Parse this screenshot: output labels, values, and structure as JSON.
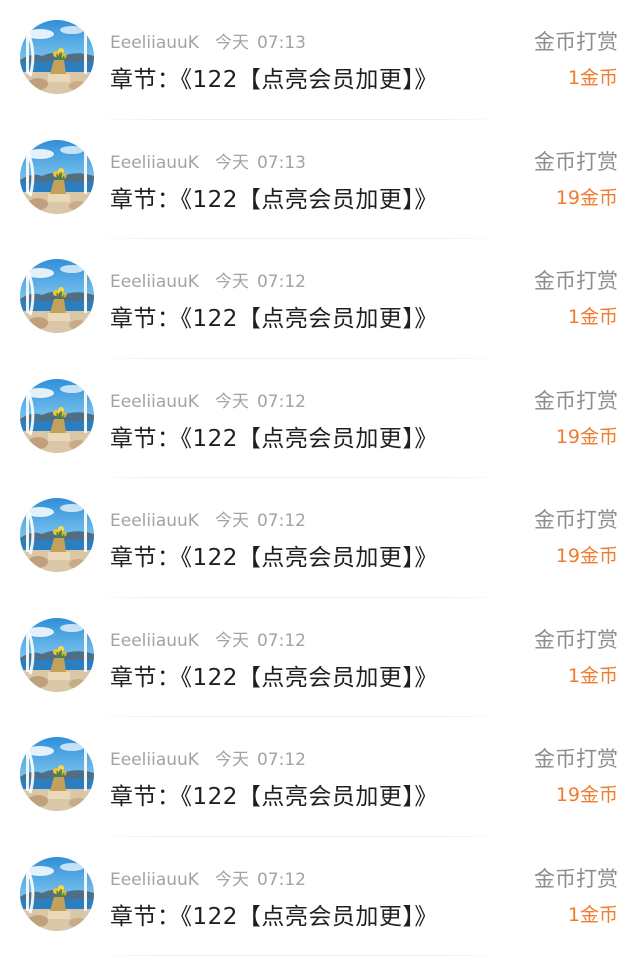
{
  "records": [
    {
      "user": "EeeliiauuK",
      "day": "今天",
      "time": "07:13",
      "chapter": "章节：《122【点亮会员加更】》",
      "reward_type": "金币打赏",
      "amount": "1金币"
    },
    {
      "user": "EeeliiauuK",
      "day": "今天",
      "time": "07:13",
      "chapter": "章节：《122【点亮会员加更】》",
      "reward_type": "金币打赏",
      "amount": "19金币"
    },
    {
      "user": "EeeliiauuK",
      "day": "今天",
      "time": "07:12",
      "chapter": "章节：《122【点亮会员加更】》",
      "reward_type": "金币打赏",
      "amount": "1金币"
    },
    {
      "user": "EeeliiauuK",
      "day": "今天",
      "time": "07:12",
      "chapter": "章节：《122【点亮会员加更】》",
      "reward_type": "金币打赏",
      "amount": "19金币"
    },
    {
      "user": "EeeliiauuK",
      "day": "今天",
      "time": "07:12",
      "chapter": "章节：《122【点亮会员加更】》",
      "reward_type": "金币打赏",
      "amount": "19金币"
    },
    {
      "user": "EeeliiauuK",
      "day": "今天",
      "time": "07:12",
      "chapter": "章节：《122【点亮会员加更】》",
      "reward_type": "金币打赏",
      "amount": "1金币"
    },
    {
      "user": "EeeliiauuK",
      "day": "今天",
      "time": "07:12",
      "chapter": "章节：《122【点亮会员加更】》",
      "reward_type": "金币打赏",
      "amount": "19金币"
    },
    {
      "user": "EeeliiauuK",
      "day": "今天",
      "time": "07:12",
      "chapter": "章节：《122【点亮会员加更】》",
      "reward_type": "金币打赏",
      "amount": "1金币"
    }
  ],
  "colors": {
    "amount": "#f07c2e",
    "meta": "#a3a3a3",
    "chapter": "#1f1f1f",
    "reward_type": "#8d8d8d"
  },
  "icons": {
    "avatar": "avatar-seaside-window-flowers"
  }
}
